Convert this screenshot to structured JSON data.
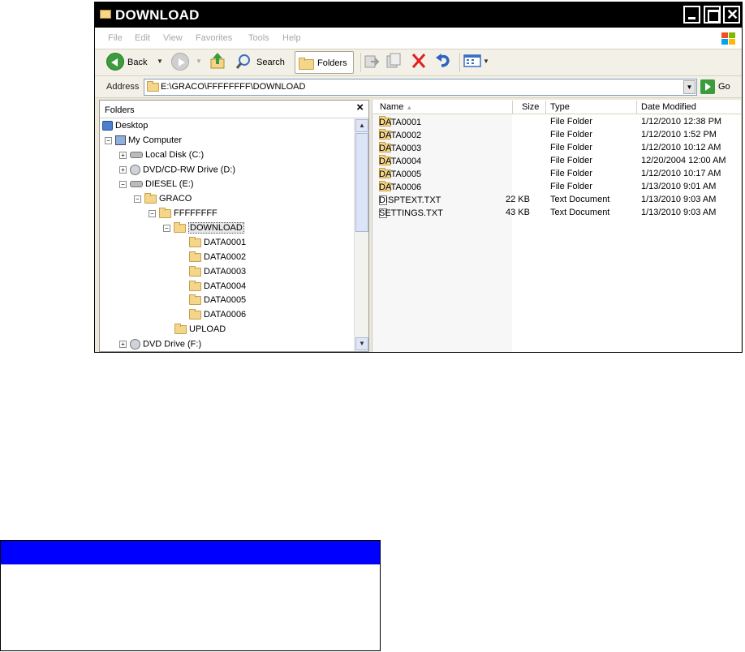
{
  "window": {
    "title": "DOWNLOAD",
    "controls": {
      "minimize": "_",
      "maximize": "□",
      "close": "✕"
    }
  },
  "menu": [
    "File",
    "Edit",
    "View",
    "Favorites",
    "Tools",
    "Help"
  ],
  "toolbar": {
    "back_label": "Back",
    "search_label": "Search",
    "folders_label": "Folders"
  },
  "address": {
    "label": "Address",
    "path": "E:\\GRACO\\FFFFFFFF\\DOWNLOAD",
    "go_label": "Go"
  },
  "folders_pane": {
    "title": "Folders",
    "close_glyph": "×",
    "tree": [
      {
        "label": "Desktop",
        "icon": "desktop-icon",
        "expander": ""
      },
      {
        "label": "My Computer",
        "icon": "computer-icon",
        "expander": "−"
      },
      {
        "label": "Local Disk (C:)",
        "icon": "drive-icon",
        "expander": "+"
      },
      {
        "label": "DVD/CD-RW Drive (D:)",
        "icon": "dvd-icon",
        "expander": "+"
      },
      {
        "label": "DIESEL (E:)",
        "icon": "drive-icon",
        "expander": "−"
      },
      {
        "label": "GRACO",
        "icon": "folder-icon",
        "expander": "−"
      },
      {
        "label": "FFFFFFFF",
        "icon": "folder-icon",
        "expander": "−"
      },
      {
        "label": "DOWNLOAD",
        "icon": "folder-icon",
        "expander": "−"
      },
      {
        "label": "DATA0001",
        "icon": "folder-icon",
        "expander": ""
      },
      {
        "label": "DATA0002",
        "icon": "folder-icon",
        "expander": ""
      },
      {
        "label": "DATA0003",
        "icon": "folder-icon",
        "expander": ""
      },
      {
        "label": "DATA0004",
        "icon": "folder-icon",
        "expander": ""
      },
      {
        "label": "DATA0005",
        "icon": "folder-icon",
        "expander": ""
      },
      {
        "label": "DATA0006",
        "icon": "folder-icon",
        "expander": ""
      },
      {
        "label": "UPLOAD",
        "icon": "folder-icon",
        "expander": ""
      },
      {
        "label": "DVD Drive (F:)",
        "icon": "dvd-icon",
        "expander": "+"
      }
    ]
  },
  "files": {
    "columns": {
      "name": "Name",
      "size": "Size",
      "type": "Type",
      "modified": "Date Modified"
    },
    "sort_glyph": "▲",
    "rows": [
      {
        "name": "DATA0001",
        "size": "",
        "type": "File Folder",
        "modified": "1/12/2010 12:38 PM"
      },
      {
        "name": "DATA0002",
        "size": "",
        "type": "File Folder",
        "modified": "1/12/2010 1:52 PM"
      },
      {
        "name": "DATA0003",
        "size": "",
        "type": "File Folder",
        "modified": "1/12/2010 10:12 AM"
      },
      {
        "name": "DATA0004",
        "size": "",
        "type": "File Folder",
        "modified": "12/20/2004 12:00 AM"
      },
      {
        "name": "DATA0005",
        "size": "",
        "type": "File Folder",
        "modified": "1/12/2010 10:17 AM"
      },
      {
        "name": "DATA0006",
        "size": "",
        "type": "File Folder",
        "modified": "1/13/2010 9:01 AM"
      },
      {
        "name": "DISPTEXT.TXT",
        "size": "22 KB",
        "type": "Text Document",
        "modified": "1/13/2010 9:03 AM"
      },
      {
        "name": "SETTINGS.TXT",
        "size": "43 KB",
        "type": "Text Document",
        "modified": "1/13/2010 9:03 AM"
      }
    ]
  }
}
